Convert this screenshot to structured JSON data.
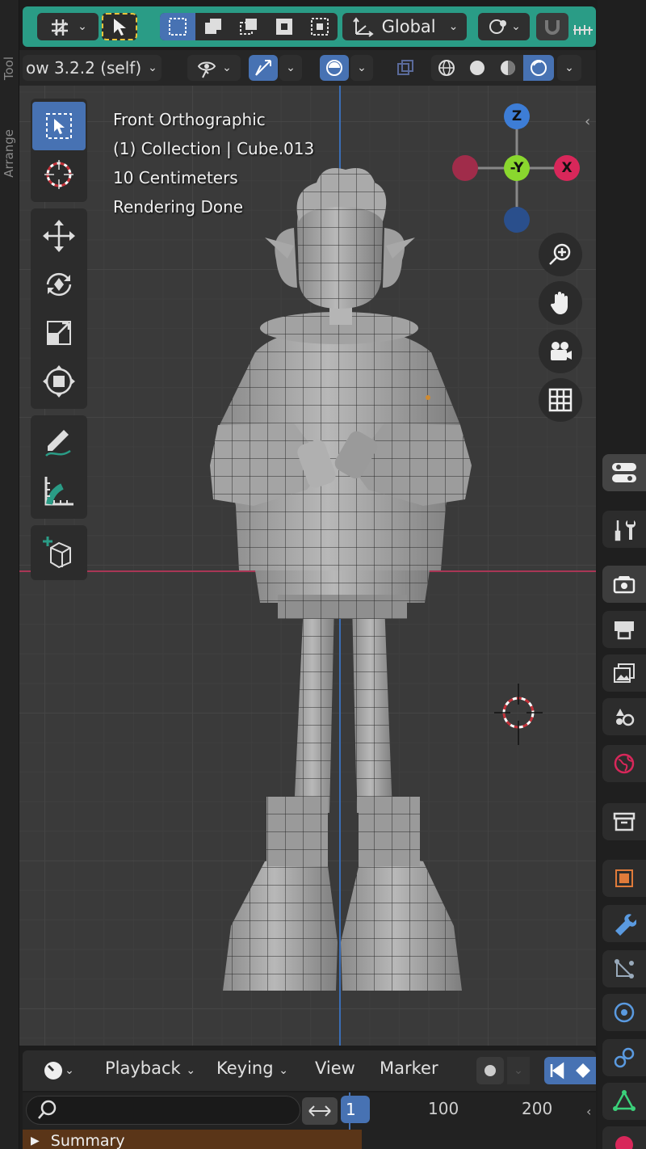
{
  "left_strip": {
    "tabs": [
      "Tool",
      "Arrange"
    ]
  },
  "header": {
    "transform_orientation": "Global",
    "select_modes": [
      "select-box",
      "extend",
      "subtract",
      "invert",
      "intersect"
    ]
  },
  "header2": {
    "render_label": "ow 3.2.2 (self)"
  },
  "viewport": {
    "view_name": "Front Orthographic",
    "collection_object": "(1) Collection | Cube.013",
    "scale": "10 Centimeters",
    "status": "Rendering Done"
  },
  "gizmo": {
    "z_label": "Z",
    "y_label": "-Y",
    "x_label": "X"
  },
  "timeline": {
    "menus": [
      "Playback",
      "Keying",
      "View",
      "Marker"
    ],
    "current_frame": "1",
    "ruler": [
      "100",
      "200"
    ],
    "summary": "Summary"
  },
  "colors": {
    "header_accent": "#2a9c86",
    "active_blue": "#4772b3",
    "x_axis": "#a83655",
    "z_axis": "#3a6db5"
  }
}
